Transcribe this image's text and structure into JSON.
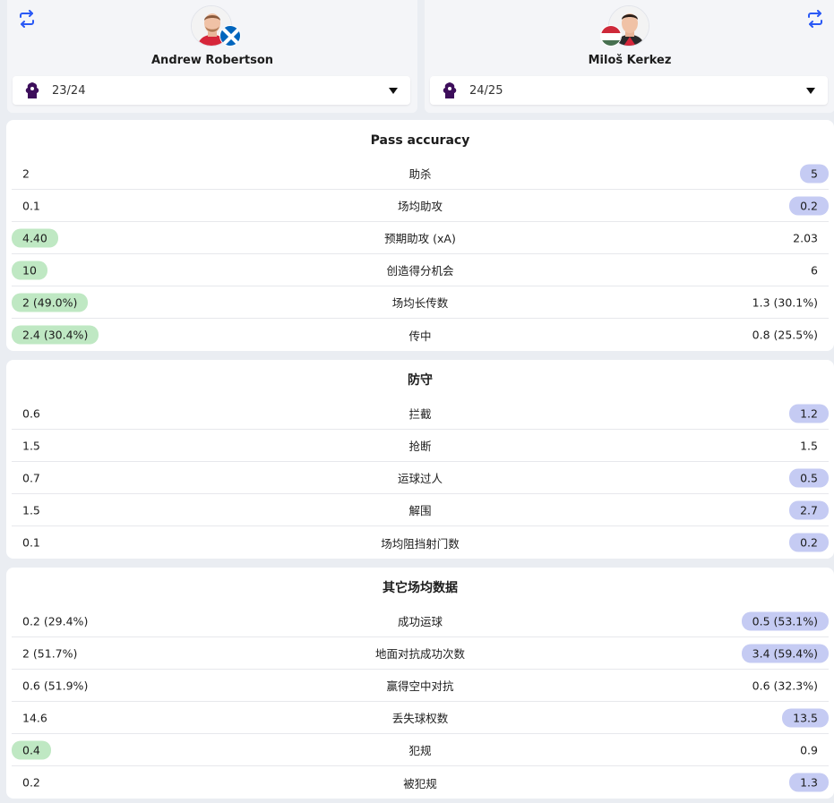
{
  "players": [
    {
      "name": "Andrew Robertson",
      "season": "23/24",
      "flag": "scotland-flag-icon"
    },
    {
      "name": "Miloš Kerkez",
      "season": "24/25",
      "flag": "hungary-flag-icon"
    }
  ],
  "colors": {
    "accent": "#2a59f5",
    "left_highlight": "#bfe8c3",
    "right_highlight": "#c5cbf3",
    "page_background": "#eaedf2"
  },
  "sections": [
    {
      "title": "Pass accuracy",
      "rows": [
        {
          "label": "助杀",
          "left": "2",
          "right": "5",
          "better": "right"
        },
        {
          "label": "场均助攻",
          "left": "0.1",
          "right": "0.2",
          "better": "right"
        },
        {
          "label": "预期助攻 (xA)",
          "left": "4.40",
          "right": "2.03",
          "better": "left"
        },
        {
          "label": "创造得分机会",
          "left": "10",
          "right": "6",
          "better": "left"
        },
        {
          "label": "场均长传数",
          "left": "2 (49.0%)",
          "right": "1.3 (30.1%)",
          "better": "left"
        },
        {
          "label": "传中",
          "left": "2.4 (30.4%)",
          "right": "0.8 (25.5%)",
          "better": "left"
        }
      ]
    },
    {
      "title": "防守",
      "rows": [
        {
          "label": "拦截",
          "left": "0.6",
          "right": "1.2",
          "better": "right"
        },
        {
          "label": "抢断",
          "left": "1.5",
          "right": "1.5",
          "better": "none"
        },
        {
          "label": "运球过人",
          "left": "0.7",
          "right": "0.5",
          "better": "right"
        },
        {
          "label": "解围",
          "left": "1.5",
          "right": "2.7",
          "better": "right"
        },
        {
          "label": "场均阻挡射门数",
          "left": "0.1",
          "right": "0.2",
          "better": "right"
        }
      ]
    },
    {
      "title": "其它场均数据",
      "rows": [
        {
          "label": "成功运球",
          "left": "0.2 (29.4%)",
          "right": "0.5 (53.1%)",
          "better": "right"
        },
        {
          "label": "地面对抗成功次数",
          "left": "2 (51.7%)",
          "right": "3.4 (59.4%)",
          "better": "right"
        },
        {
          "label": "赢得空中对抗",
          "left": "0.6 (51.9%)",
          "right": "0.6 (32.3%)",
          "better": "none"
        },
        {
          "label": "丢失球权数",
          "left": "14.6",
          "right": "13.5",
          "better": "right"
        },
        {
          "label": "犯规",
          "left": "0.4",
          "right": "0.9",
          "better": "left"
        },
        {
          "label": "被犯规",
          "left": "0.2",
          "right": "1.3",
          "better": "right"
        }
      ]
    }
  ]
}
